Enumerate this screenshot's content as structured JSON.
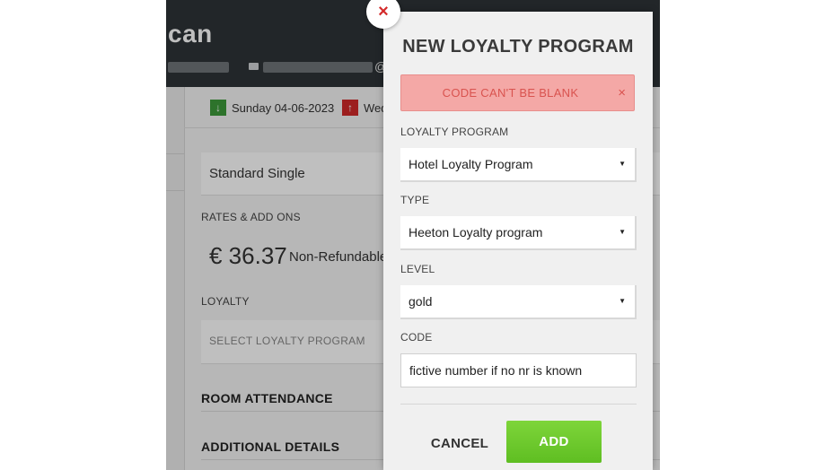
{
  "background_app": {
    "guest_name_partial": "can",
    "arrival_date": "Sunday 04-06-2023",
    "departure_partial": "Wed",
    "room_type": "Standard Single",
    "rates_label": "RATES & ADD ONS",
    "rate_price": "€ 36.37",
    "rate_name": "Non-Refundable",
    "loyalty_label": "LOYALTY",
    "loyalty_placeholder": "SELECT LOYALTY PROGRAM",
    "room_attendance_heading": "ROOM ATTENDANCE",
    "additional_details_heading": "ADDITIONAL DETAILS"
  },
  "modal": {
    "title": "NEW LOYALTY PROGRAM",
    "error": {
      "text": "CODE CAN'T BE BLANK",
      "close": "×"
    },
    "close_icon": "×",
    "fields": {
      "program": {
        "label": "LOYALTY PROGRAM",
        "value": "Hotel Loyalty Program"
      },
      "type": {
        "label": "TYPE",
        "value": "Heeton Loyalty program"
      },
      "level": {
        "label": "LEVEL",
        "value": "gold"
      },
      "code": {
        "label": "CODE",
        "value": "fictive number if no nr is known"
      }
    },
    "caret": "▼",
    "cancel_label": "CANCEL",
    "add_label": "ADD"
  },
  "icons": {
    "arrival": "arrow-down-icon",
    "departure": "arrow-up-icon",
    "close": "close-icon",
    "mail": "mail-icon",
    "caret": "caret-down-icon"
  },
  "colors": {
    "header_bg": "#2e3337",
    "alert_bg": "#f4a8a6",
    "alert_text": "#d9534f",
    "add_button": "#6ac82b",
    "close_x": "#d42a2a"
  }
}
